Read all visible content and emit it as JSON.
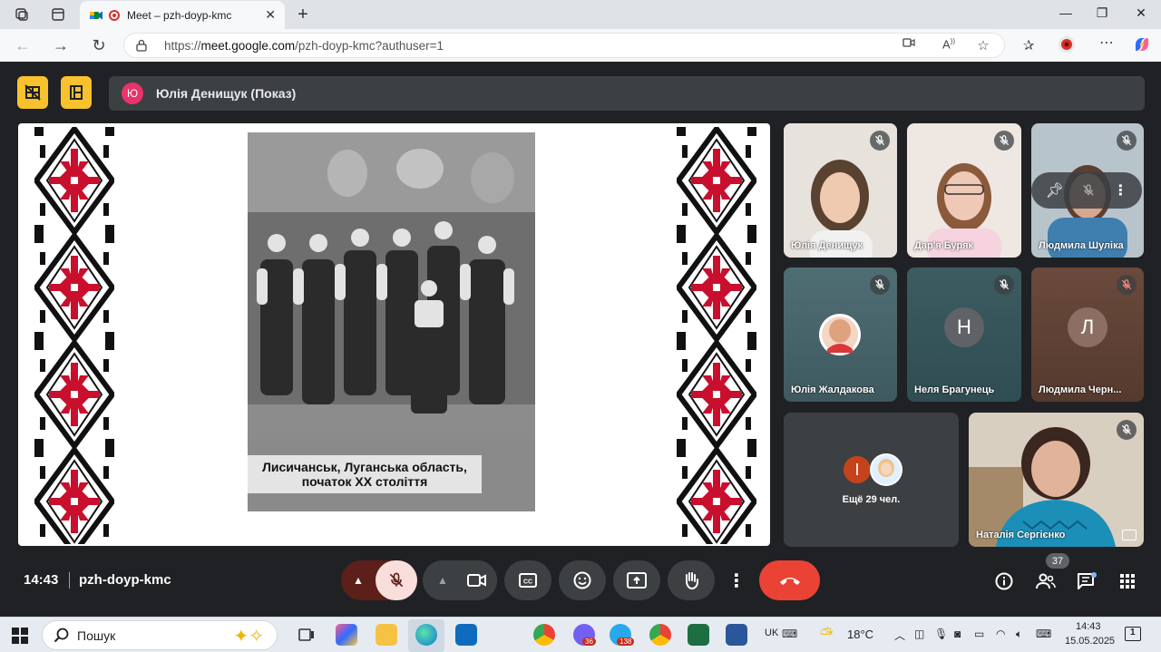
{
  "browser": {
    "tab_title": "Meet – pzh-doyp-kmc",
    "url_prefix": "https://",
    "url_host": "meet.google.com",
    "url_path": "/pzh-doyp-kmc?authuser=1"
  },
  "presentation_bar": {
    "avatar_letter": "Ю",
    "presenter_label": "Юлія Денищук (Показ)"
  },
  "slide": {
    "caption_line1": "Лисичанськ, Луганська область,",
    "caption_line2": "початок XX століття"
  },
  "participants": [
    {
      "name": "Юлія Денищук"
    },
    {
      "name": "Дар'я Буряк"
    },
    {
      "name": "Людмила Шуліка"
    },
    {
      "name": "Юлія Жалдакова"
    },
    {
      "name": "Неля Брагунець",
      "letter": "Н"
    },
    {
      "name": "Людмила Черн...",
      "letter": "Л"
    },
    {
      "name": "Наталія Сергієнко"
    }
  ],
  "more_tile": {
    "letter": "І",
    "label": "Ещё 29 чел."
  },
  "meeting": {
    "time": "14:43",
    "code": "pzh-doyp-kmc",
    "people_count": "37"
  },
  "taskbar": {
    "search_placeholder": "Пошук",
    "lang": "UK",
    "temperature": "18°C",
    "clock_time": "14:43",
    "clock_date": "15.05.2025",
    "viber_badge": "36",
    "telegram_badge": "138",
    "notif_count": "1"
  },
  "colors": {
    "meet_bg": "#202124",
    "accent_yellow": "#f9c12e",
    "end_call_red": "#ea4335",
    "mic_off_red": "#f9dedc",
    "ornament_red": "#c8102e"
  }
}
